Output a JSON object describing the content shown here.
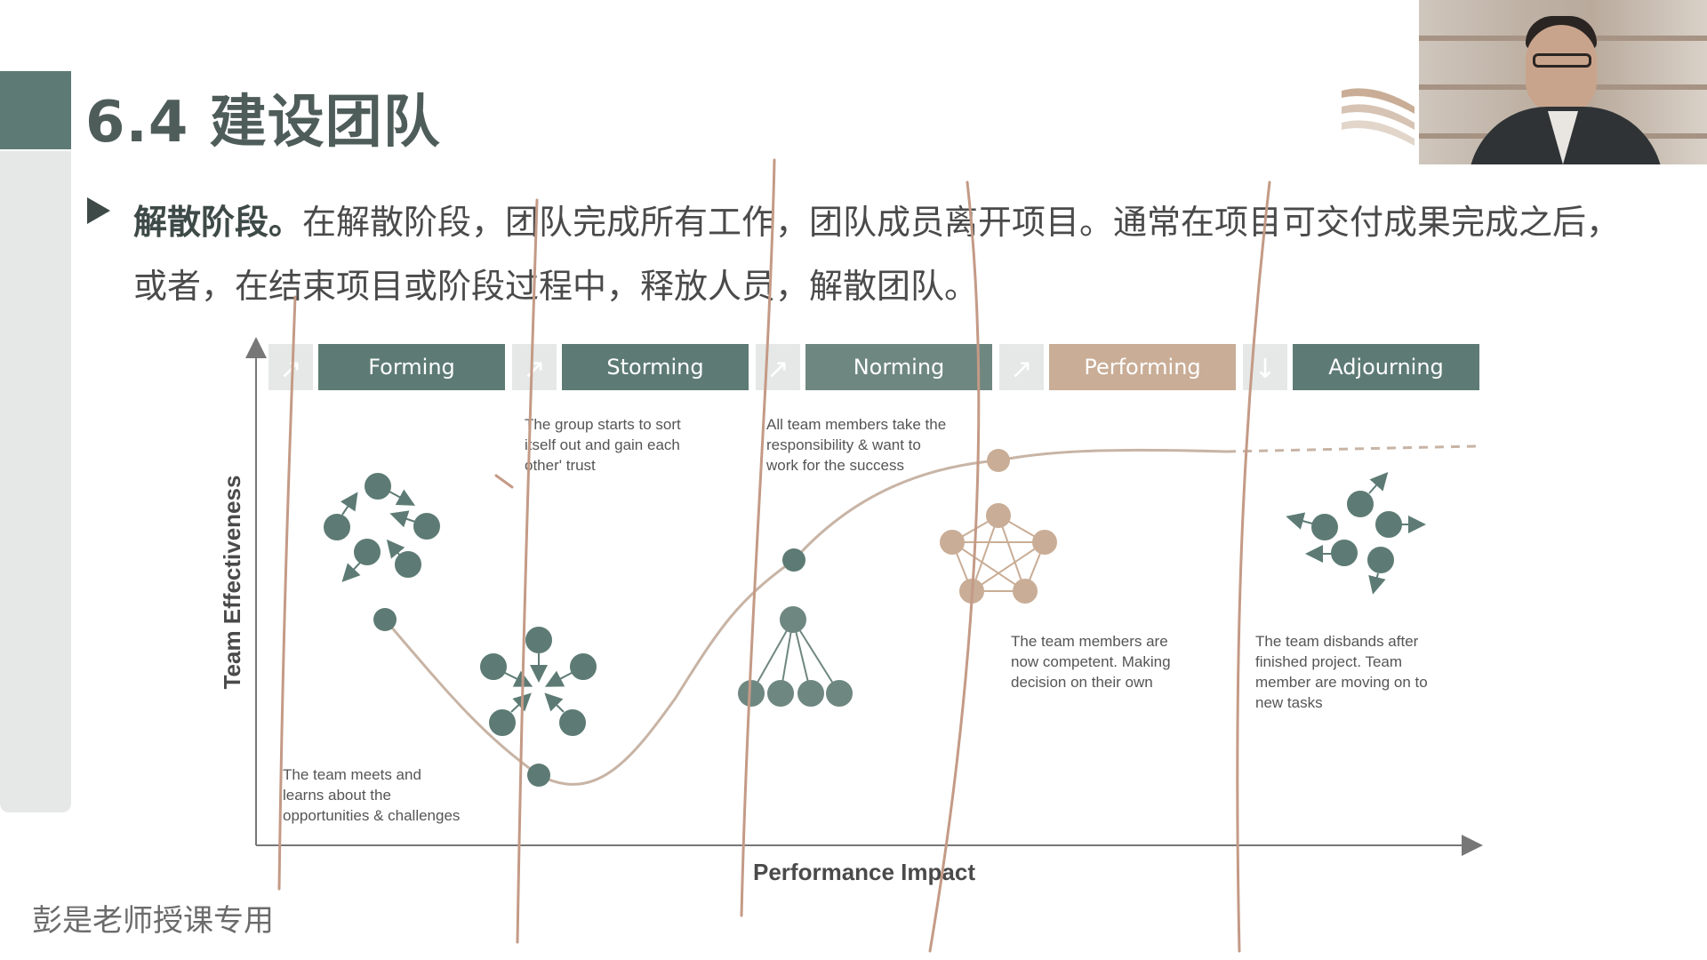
{
  "slide": {
    "title": "6.4 建设团队",
    "paragraph": {
      "lead": "解散阶段。",
      "body": "在解散阶段，团队完成所有工作，团队成员离开项目。通常在项目可交付成果完成之后，或者，在结束项目或阶段过程中，释放人员，解散团队。"
    },
    "watermark": "彭是老师授课专用"
  },
  "colors": {
    "teal": "#5d7b74",
    "beige": "#c9ad96",
    "curve": "#c8b4a5",
    "text_dark": "#4a4a4a"
  },
  "diagram": {
    "y_axis_label": "Team Effectiveness",
    "x_axis_label": "Performance Impact",
    "stages": [
      {
        "name": "Forming",
        "icon": "arrow-up-right-icon",
        "color": "#5d7b74",
        "lines": [
          "The team meets and",
          "learns about the",
          "opportunities & challenges"
        ]
      },
      {
        "name": "Storming",
        "icon": "arrow-up-right-icon",
        "color": "#5d7b74",
        "lines": [
          "The group starts to sort",
          "itself out and gain each",
          "other' trust"
        ]
      },
      {
        "name": "Norming",
        "icon": "arrow-up-right-icon",
        "color": "#6f8781",
        "lines": [
          "All team members take the",
          "responsibility & want to",
          "work for the success"
        ]
      },
      {
        "name": "Performing",
        "icon": "arrow-up-right-icon",
        "color": "#c9ad96",
        "lines": [
          "The team members are",
          "now competent. Making",
          "decision on their own"
        ]
      },
      {
        "name": "Adjourning",
        "icon": "arrow-down-icon",
        "color": "#5d7b74",
        "lines": [
          "The team disbands after",
          "finished project. Team",
          "member are moving on to",
          "new tasks"
        ]
      }
    ]
  }
}
